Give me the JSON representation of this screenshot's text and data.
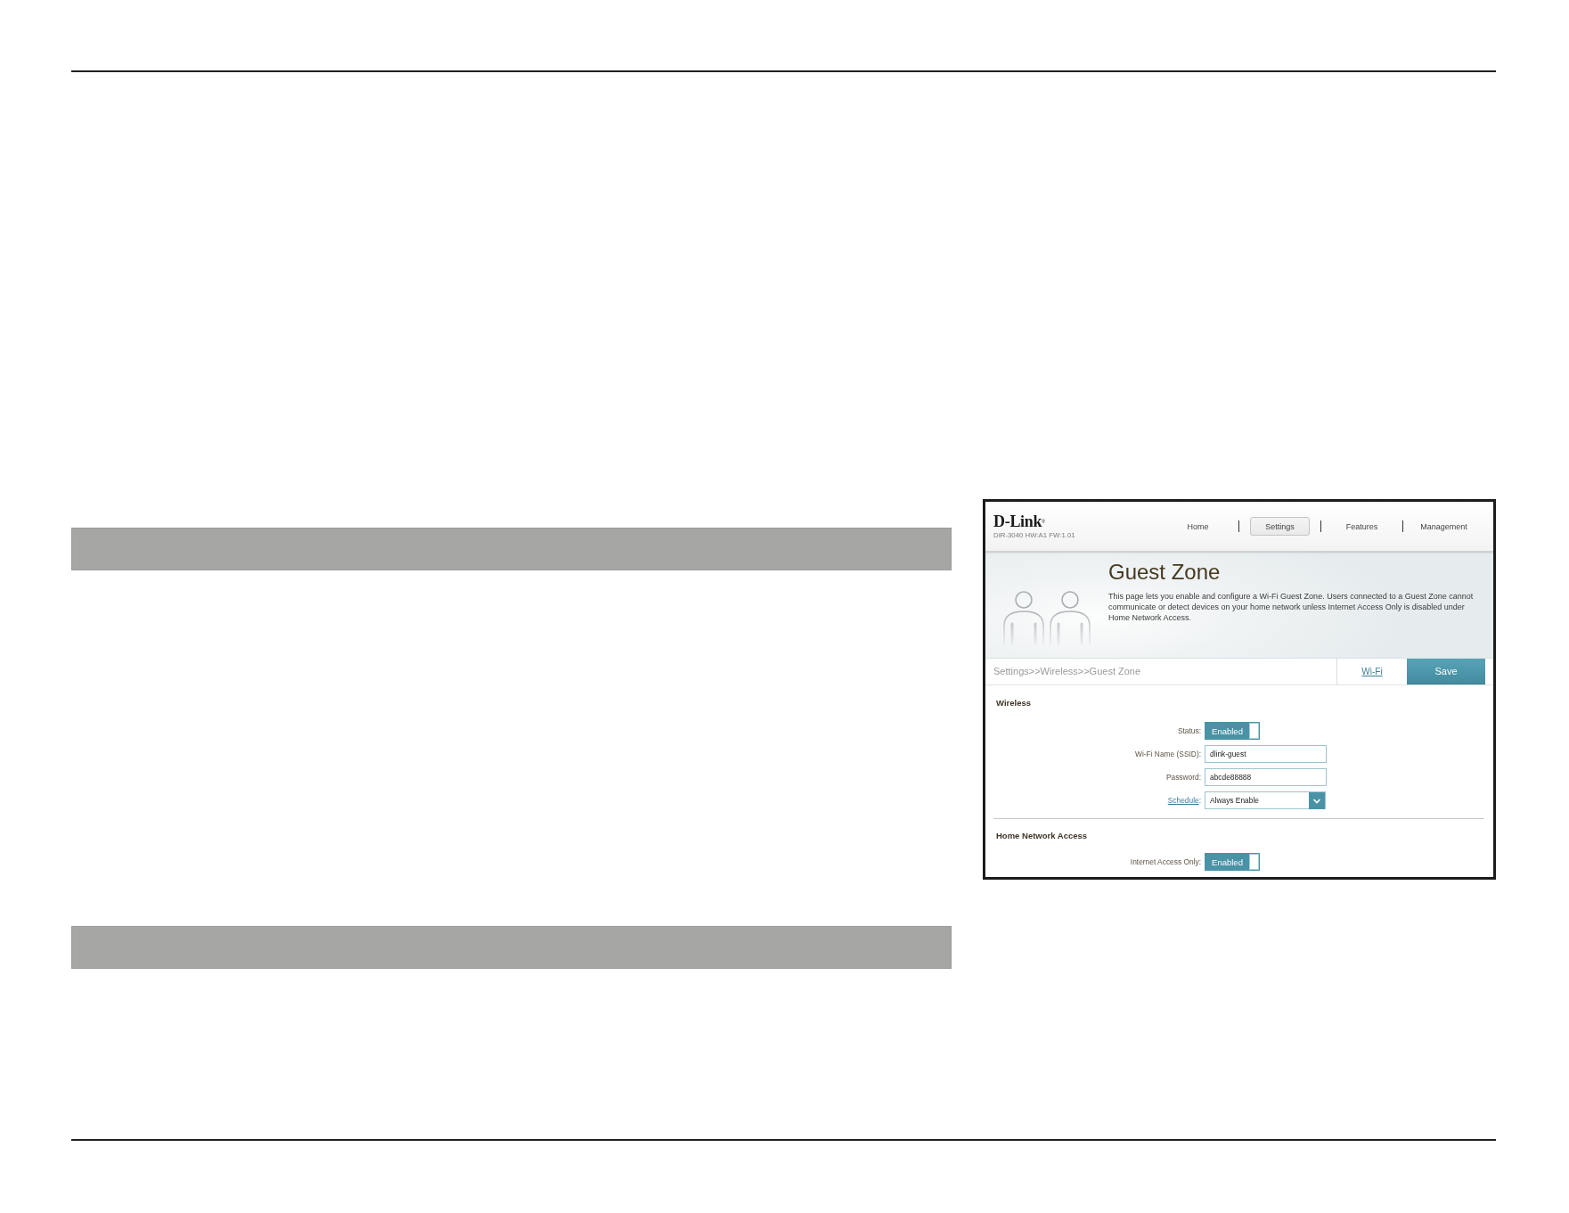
{
  "screenshot": {
    "logo": "D-Link$^{®}$",
    "model_info": "DIR-3040 HW:A1 FW:1.01",
    "nav_tabs": [
      {
        "label": "Home",
        "selected": false
      },
      {
        "label": "Settings",
        "selected": true
      },
      {
        "label": "Features",
        "selected": false
      },
      {
        "label": "Management",
        "selected": false
      }
    ],
    "page_title": "Guest Zone",
    "description": "This page lets you enable and configure a Wi-Fi Guest Zone. Users connected to a Guest Zone cannot communicate or detect devices on your home network unless Internet Access Only is disabled under Home Network Access.",
    "breadcrumb": "Settings>>Wireless>>Guest Zone",
    "wifi_link": "Wi-Fi",
    "save_button": "Save",
    "sections": [
      {
        "title": "Wireless",
        "fields": [
          {
            "kind": "toggle",
            "label": "Status:",
            "value": "Enabled",
            "on": true
          },
          {
            "kind": "text",
            "label": "Wi-Fi Name (SSID):",
            "value": "dlink-guest"
          },
          {
            "kind": "text",
            "label": "Password:",
            "value": "abcde88888"
          },
          {
            "kind": "select",
            "label_link": "Schedule",
            "label_suffix": ":",
            "value": "Always Enable"
          }
        ]
      },
      {
        "title": "Home Network Access",
        "fields": [
          {
            "kind": "toggle",
            "label": "Internet Access Only:",
            "value": "Enabled",
            "on": true
          }
        ]
      }
    ]
  }
}
